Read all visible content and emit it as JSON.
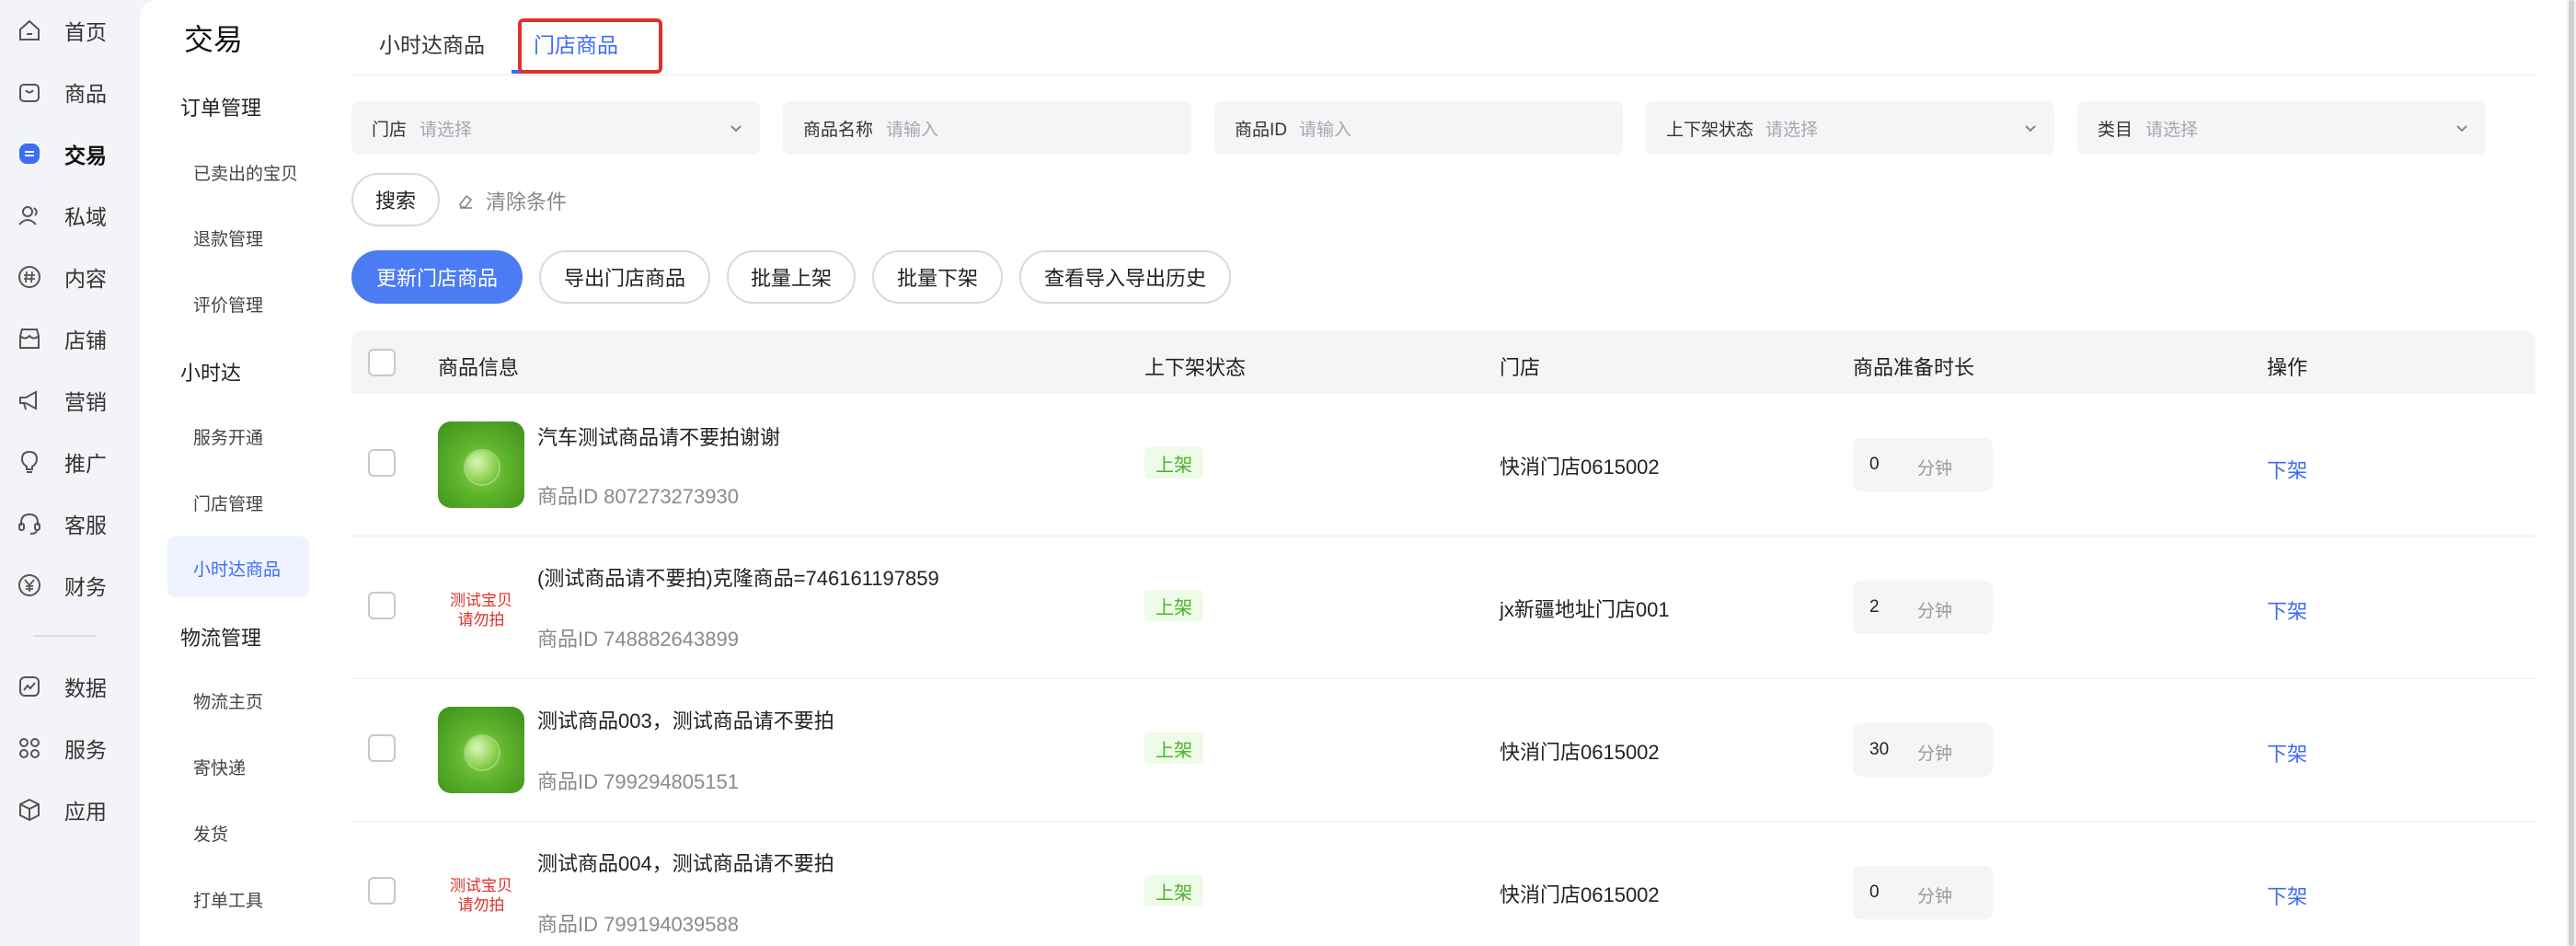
{
  "rail": {
    "items": [
      {
        "label": "首页",
        "icon": "home-icon"
      },
      {
        "label": "商品",
        "icon": "bag-icon"
      },
      {
        "label": "交易",
        "icon": "trade-icon"
      },
      {
        "label": "私域",
        "icon": "users-icon"
      },
      {
        "label": "内容",
        "icon": "hash-icon"
      },
      {
        "label": "店铺",
        "icon": "store-icon"
      },
      {
        "label": "营销",
        "icon": "megaphone-icon"
      },
      {
        "label": "推广",
        "icon": "bulb-icon"
      },
      {
        "label": "客服",
        "icon": "headset-icon"
      },
      {
        "label": "财务",
        "icon": "yen-icon"
      },
      {
        "label": "数据",
        "icon": "chart-icon"
      },
      {
        "label": "服务",
        "icon": "grid-icon"
      },
      {
        "label": "应用",
        "icon": "cube-icon"
      }
    ],
    "active_index": 2
  },
  "menu": {
    "title": "交易",
    "groups": [
      {
        "label": "订单管理",
        "items": [
          "已卖出的宝贝",
          "退款管理",
          "评价管理"
        ]
      },
      {
        "label": "小时达",
        "items": [
          "服务开通",
          "门店管理",
          "小时达商品"
        ]
      },
      {
        "label": "物流管理",
        "items": [
          "物流主页",
          "寄快递",
          "发货",
          "打单工具"
        ]
      }
    ],
    "active_item": "小时达商品"
  },
  "tabs": [
    {
      "label": "小时达商品"
    },
    {
      "label": "门店商品"
    }
  ],
  "active_tab": 1,
  "filters": [
    {
      "label": "门店",
      "placeholder": "请选择",
      "type": "select"
    },
    {
      "label": "商品名称",
      "placeholder": "请输入",
      "type": "input"
    },
    {
      "label": "商品ID",
      "placeholder": "请输入",
      "type": "input"
    },
    {
      "label": "上下架状态",
      "placeholder": "请选择",
      "type": "select"
    },
    {
      "label": "类目",
      "placeholder": "请选择",
      "type": "select"
    }
  ],
  "search_button": "搜索",
  "clear_link": "清除条件",
  "actions": [
    "更新门店商品",
    "导出门店商品",
    "批量上架",
    "批量下架",
    "查看导入导出历史"
  ],
  "table": {
    "headers": [
      "商品信息",
      "上下架状态",
      "门店",
      "商品准备时长",
      "操作"
    ],
    "id_prefix": "商品ID",
    "unit": "分钟",
    "rows": [
      {
        "name": "汽车测试商品请不要拍谢谢",
        "id": "807273273930",
        "status": "上架",
        "store": "快消门店0615002",
        "prep": "0",
        "action": "下架",
        "thumb": "leaf"
      },
      {
        "name": "(测试商品请不要拍)克隆商品=746161197859",
        "id": "748882643899",
        "status": "上架",
        "store": "jx新疆地址门店001",
        "prep": "2",
        "action": "下架",
        "thumb": "text",
        "thumb_text": [
          "测试宝贝",
          "请勿拍"
        ]
      },
      {
        "name": "测试商品003，测试商品请不要拍",
        "id": "799294805151",
        "status": "上架",
        "store": "快消门店0615002",
        "prep": "30",
        "action": "下架",
        "thumb": "leaf"
      },
      {
        "name": "测试商品004，测试商品请不要拍",
        "id": "799194039588",
        "status": "上架",
        "store": "快消门店0615002",
        "prep": "0",
        "action": "下架",
        "thumb": "text",
        "thumb_text": [
          "测试宝贝",
          "请勿拍"
        ]
      }
    ]
  },
  "colors": {
    "accent": "#3d6cf5",
    "primary_button": "#4c7cf3",
    "status_green": "#4fb32a",
    "highlight": "#e0302a"
  }
}
